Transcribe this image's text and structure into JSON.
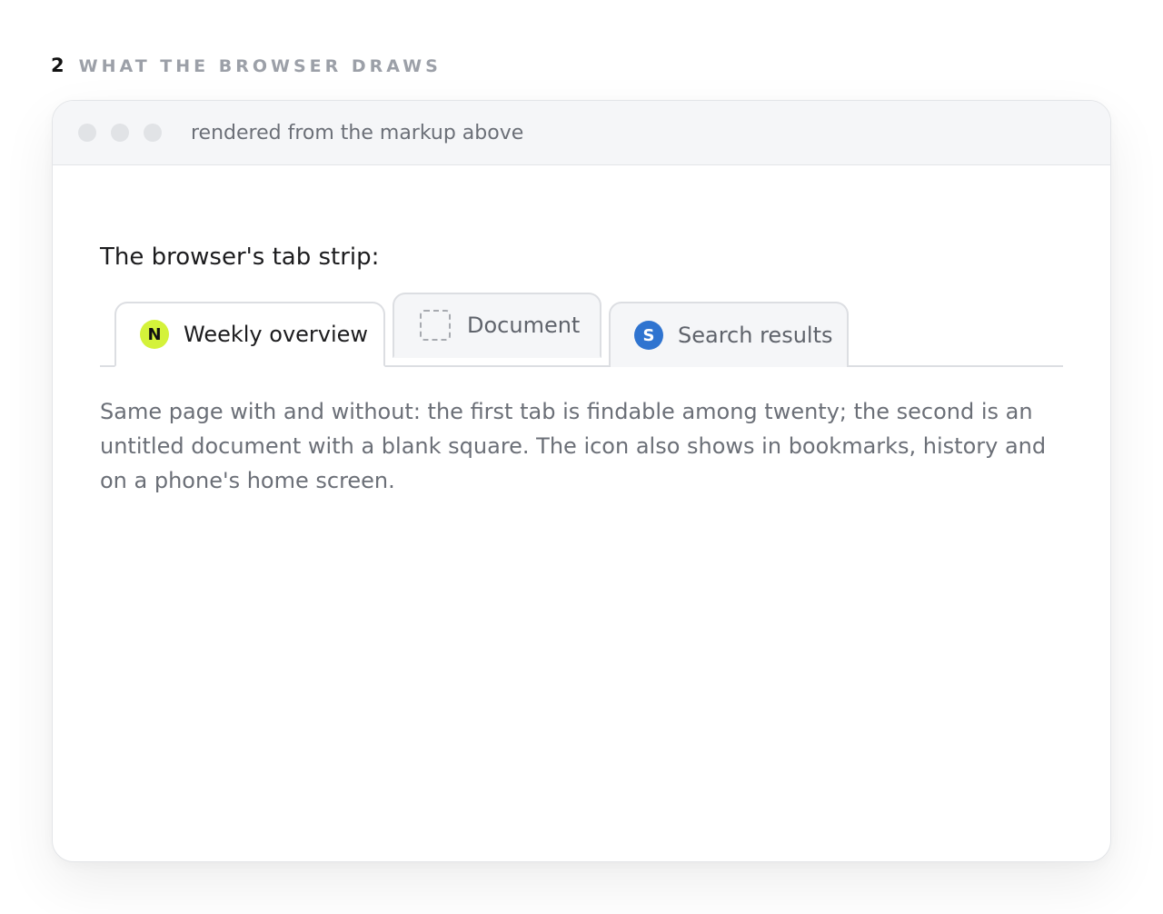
{
  "section": {
    "number": "2",
    "title": "WHAT THE BROWSER DRAWS"
  },
  "window": {
    "caption": "rendered from the markup above",
    "lead": "The browser's tab strip:",
    "tabs": [
      {
        "label": "Weekly overview",
        "favicon_letter": "N",
        "favicon_color": "#d4f23a",
        "active": true
      },
      {
        "label": "Document",
        "favicon": "blank-square-icon",
        "active": false
      },
      {
        "label": "Search results",
        "favicon_letter": "S",
        "favicon_color": "#2f74d0",
        "active": false
      }
    ],
    "description": "Same page with and without: the first tab is findable among twenty; the second is an untitled document with a blank square. The icon also shows in bookmarks, history and on a phone's home screen."
  }
}
